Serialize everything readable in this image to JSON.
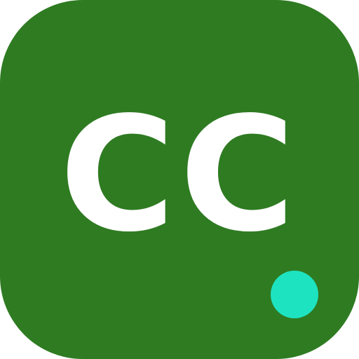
{
  "icon": {
    "label": "CC",
    "background_color": "#2f7b22",
    "text_color": "#ffffff"
  },
  "status_dot": {
    "color": "#1ee3c0",
    "icon_name": "status-dot-icon"
  }
}
